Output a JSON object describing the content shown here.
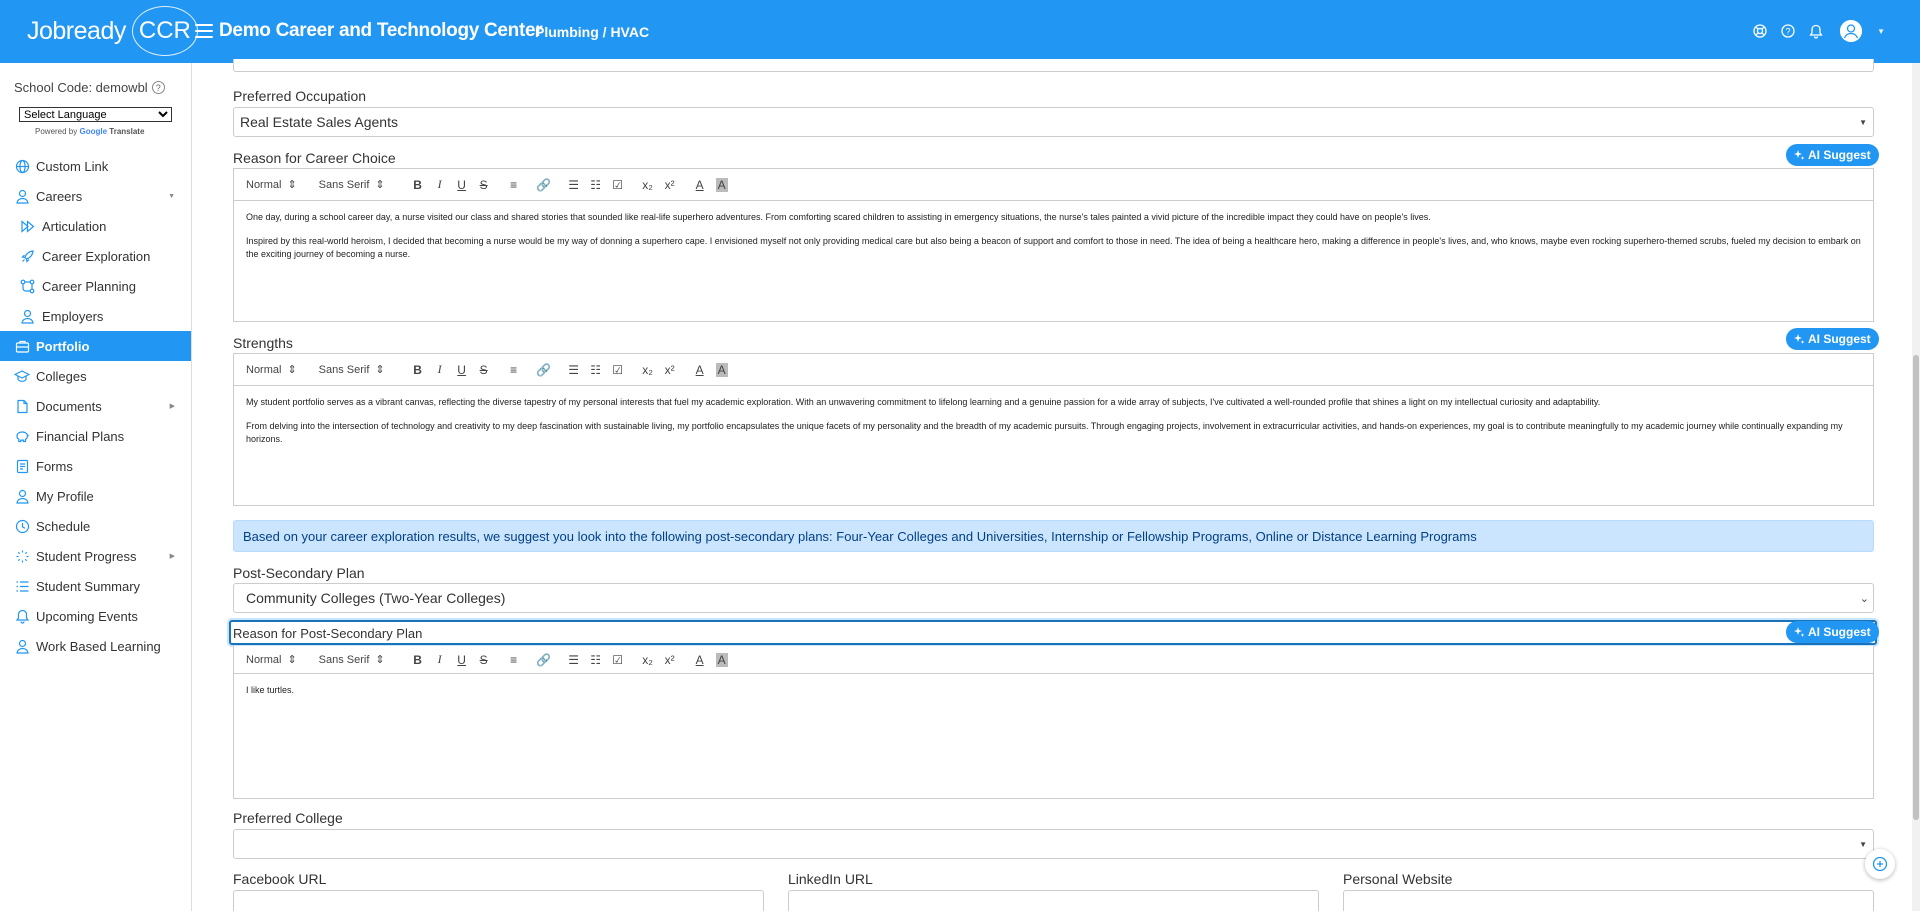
{
  "header": {
    "logo_text": "Jobready",
    "logo_ccr": "CCR",
    "school_name": "Demo Career and Technology Center",
    "program": "Plumbing / HVAC"
  },
  "sidebar": {
    "school_code": "School Code: demowbl",
    "language_select": "Select Language",
    "powered_by": "Powered by",
    "google": "Google",
    "translate": "Translate",
    "items": [
      {
        "label": "Custom Link",
        "icon": "globe-icon"
      },
      {
        "label": "Careers",
        "icon": "user-icon"
      },
      {
        "label": "Articulation",
        "icon": "articulation-icon"
      },
      {
        "label": "Career Exploration",
        "icon": "rocket-icon"
      },
      {
        "label": "Career Planning",
        "icon": "planning-icon"
      },
      {
        "label": "Employers",
        "icon": "user-icon"
      },
      {
        "label": "Portfolio",
        "icon": "briefcase-icon"
      },
      {
        "label": "Colleges",
        "icon": "graduation-cap-icon"
      },
      {
        "label": "Documents",
        "icon": "document-icon"
      },
      {
        "label": "Financial Plans",
        "icon": "piggy-bank-icon"
      },
      {
        "label": "Forms",
        "icon": "form-icon"
      },
      {
        "label": "My Profile",
        "icon": "user-icon"
      },
      {
        "label": "Schedule",
        "icon": "clock-icon"
      },
      {
        "label": "Student Progress",
        "icon": "progress-icon"
      },
      {
        "label": "Student Summary",
        "icon": "list-icon"
      },
      {
        "label": "Upcoming Events",
        "icon": "bell-icon"
      },
      {
        "label": "Work Based Learning",
        "icon": "user-icon"
      }
    ]
  },
  "main": {
    "preferred_occupation_label": "Preferred Occupation",
    "preferred_occupation_value": "Real Estate Sales Agents",
    "reason_career_label": "Reason for Career Choice",
    "ai_suggest": "AI Suggest",
    "toolbar": {
      "format": "Normal",
      "font": "Sans Serif"
    },
    "reason_career_p1": "One day, during a school career day, a nurse visited our class and shared stories that sounded like real-life superhero adventures. From comforting scared children to assisting in emergency situations, the nurse's tales painted a vivid picture of the incredible impact they could have on people's lives.",
    "reason_career_p2": "Inspired by this real-world heroism, I decided that becoming a nurse would be my way of donning a superhero cape. I envisioned myself not only providing medical care but also being a beacon of support and comfort to those in need. The idea of being a healthcare hero, making a difference in people's lives, and, who knows, maybe even rocking superhero-themed scrubs, fueled my decision to embark on the exciting journey of becoming a nurse.",
    "strengths_label": "Strengths",
    "strengths_p1": "My student portfolio serves as a vibrant canvas, reflecting the diverse tapestry of my personal interests that fuel my academic exploration. With an unwavering commitment to lifelong learning and a genuine passion for a wide array of subjects, I've cultivated a well-rounded profile that shines a light on my intellectual curiosity and adaptability.",
    "strengths_p2": "From delving into the intersection of technology and creativity to my deep fascination with sustainable living, my portfolio encapsulates the unique facets of my personality and the breadth of my academic pursuits. Through engaging projects, involvement in extracurricular activities, and hands-on experiences, my goal is to contribute meaningfully to my academic journey while continually expanding my horizons.",
    "suggestion_text": "Based on your career exploration results, we suggest you look into the following post-secondary plans: Four-Year Colleges and Universities, Internship or Fellowship Programs, Online or Distance Learning Programs",
    "post_secondary_label": "Post-Secondary Plan",
    "post_secondary_value": "Community Colleges (Two-Year Colleges)",
    "reason_post_label": "Reason for Post-Secondary Plan",
    "reason_post_text": "I like turtles.",
    "preferred_college_label": "Preferred College",
    "preferred_college_value": "",
    "facebook_label": "Facebook URL",
    "linkedin_label": "LinkedIn URL",
    "website_label": "Personal Website"
  },
  "colors": {
    "primary": "#2196f3",
    "info_bg": "#cce5ff",
    "info_text": "#004085"
  }
}
